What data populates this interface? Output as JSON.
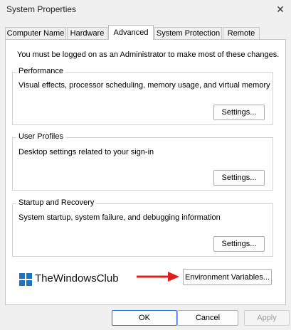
{
  "window": {
    "title": "System Properties",
    "close_glyph": "✕"
  },
  "tabs": [
    {
      "label": "Computer Name"
    },
    {
      "label": "Hardware"
    },
    {
      "label": "Advanced"
    },
    {
      "label": "System Protection"
    },
    {
      "label": "Remote"
    }
  ],
  "panel": {
    "note": "You must be logged on as an Administrator to make most of these changes.",
    "performance": {
      "label": "Performance",
      "description": "Visual effects, processor scheduling, memory usage, and virtual memory",
      "settings_label": "Settings..."
    },
    "user_profiles": {
      "label": "User Profiles",
      "description": "Desktop settings related to your sign-in",
      "settings_label": "Settings..."
    },
    "startup_recovery": {
      "label": "Startup and Recovery",
      "description": "System startup, system failure, and debugging information",
      "settings_label": "Settings..."
    },
    "env_vars_label": "Environment Variables..."
  },
  "watermark": {
    "text": "TheWindowsClub",
    "logo_color": "#1e73be",
    "arrow_color": "#e11d1d"
  },
  "footer": {
    "ok_label": "OK",
    "cancel_label": "Cancel",
    "apply_label": "Apply"
  }
}
